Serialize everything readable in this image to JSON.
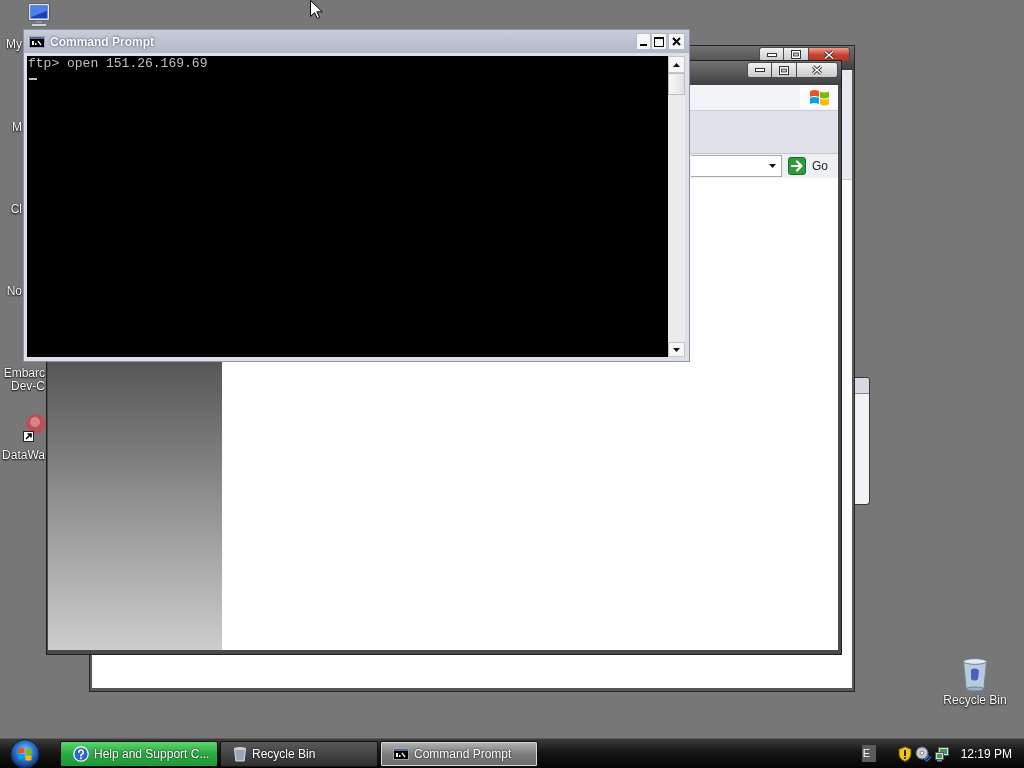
{
  "desktop_icons": [
    {
      "kind": "computer",
      "lines": [
        "My"
      ]
    },
    {
      "kind": "covered",
      "lines": [
        "M"
      ]
    },
    {
      "kind": "covered",
      "lines": [
        "Cl"
      ]
    },
    {
      "kind": "covered",
      "lines": [
        "No"
      ]
    },
    {
      "kind": "covered",
      "lines": [
        "Embarc",
        "Dev-C"
      ]
    },
    {
      "kind": "shortcut",
      "lines": [
        "DataWa"
      ]
    }
  ],
  "recycle_bin": {
    "label": "Recycle Bin"
  },
  "browser_window": {
    "go_button": "Go"
  },
  "command_prompt": {
    "title": "Command Prompt",
    "lines": [
      "ftp> open 151.26.169.69"
    ]
  },
  "taskbar": {
    "tasks": [
      {
        "kind": "help",
        "label": "Help and Support C...",
        "selected": false,
        "flashing": true
      },
      {
        "kind": "recycle",
        "label": "Recycle Bin",
        "selected": false,
        "flashing": false
      },
      {
        "kind": "console",
        "label": "Command Prompt",
        "selected": true,
        "flashing": false
      }
    ],
    "language": "E",
    "clock": "12:19 PM"
  }
}
